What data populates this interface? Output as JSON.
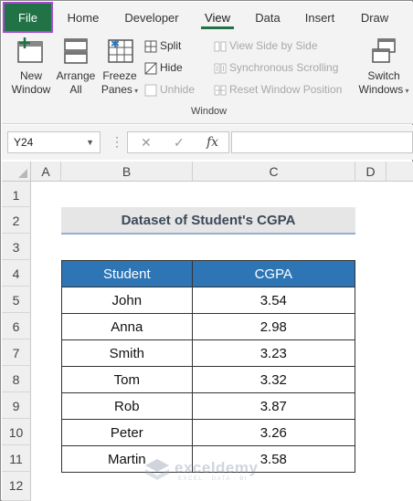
{
  "ribbon_tabs": [
    "File",
    "Home",
    "Developer",
    "View",
    "Data",
    "Insert",
    "Draw"
  ],
  "ribbon": {
    "new_window": "New Window",
    "arrange_all": "Arrange All",
    "freeze_panes": "Freeze Panes",
    "split": "Split",
    "hide": "Hide",
    "unhide": "Unhide",
    "view_side_by_side": "View Side by Side",
    "synchronous_scrolling": "Synchronous Scrolling",
    "reset_window_position": "Reset Window Position",
    "switch_windows": "Switch Windows",
    "group_label": "Window"
  },
  "formula_bar": {
    "name_box": "Y24",
    "fx": "fx",
    "formula": ""
  },
  "sheet": {
    "columns": [
      "A",
      "B",
      "C",
      "D"
    ],
    "rows": [
      "1",
      "2",
      "3",
      "4",
      "5",
      "6",
      "7",
      "8",
      "9",
      "10",
      "11",
      "12"
    ],
    "title": "Dataset of Student's CGPA",
    "headers": [
      "Student",
      "CGPA"
    ],
    "data": [
      [
        "John",
        "3.54"
      ],
      [
        "Anna",
        "2.98"
      ],
      [
        "Smith",
        "3.23"
      ],
      [
        "Tom",
        "3.32"
      ],
      [
        "Rob",
        "3.87"
      ],
      [
        "Peter",
        "3.26"
      ],
      [
        "Martin",
        "3.58"
      ]
    ]
  },
  "watermark": {
    "name": "exceldemy",
    "tagline": "EXCEL · DATA · BI"
  },
  "colors": {
    "file_tab": "#217346",
    "selected_outline": "#a64bd2",
    "header_fill": "#2e75b6",
    "title_fill": "#e7e6e6"
  }
}
